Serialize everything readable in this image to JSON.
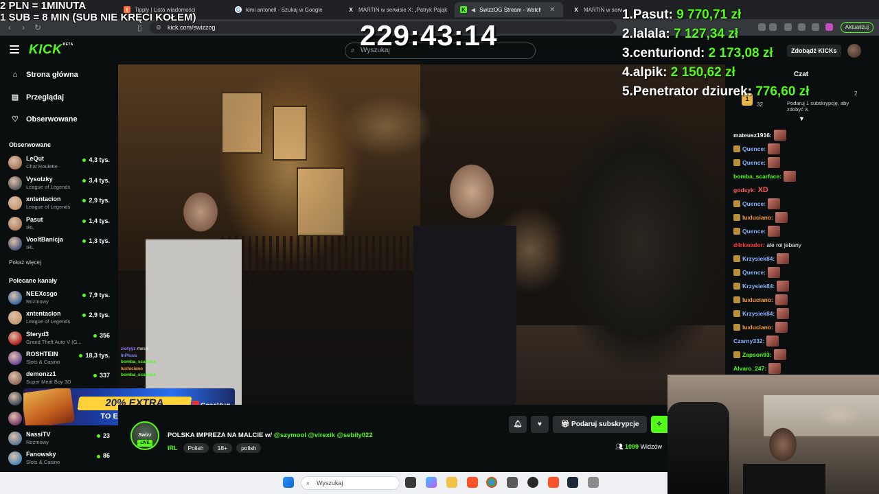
{
  "overlay": {
    "rate_line1": "2 PLN =  1MINUTA",
    "rate_line2": "1 SUB = 8 MIN (SUB NIE KRĘCI KOŁEM)",
    "timer": "229:43:14",
    "leaderboard": [
      {
        "rank_name": "1.Pasut:",
        "amount": "9 770,71 zł"
      },
      {
        "rank_name": "2.lalala:",
        "amount": "7 127,34 zł"
      },
      {
        "rank_name": "3.centuriond:",
        "amount": "2 173,08 zł"
      },
      {
        "rank_name": "4.alpik:",
        "amount": "2 150,62 zł"
      },
      {
        "rank_name": "5.Penetrator dziurek:",
        "amount": "776,60 zł"
      }
    ]
  },
  "browser": {
    "tabs": [
      {
        "label": "Tipply | Lista wiadomości",
        "active": false
      },
      {
        "label": "kimi antonell - Szukaj w Google",
        "active": false
      },
      {
        "label": "MARTIN w serwisie X: „Patryk Pająk",
        "active": false
      },
      {
        "label": "SwizzOG Stream - Watch Live",
        "active": true
      },
      {
        "label": "MARTIN w serwisie X: „Dzięki mocy",
        "active": false
      }
    ],
    "url": "kick.com/swizzog",
    "update_label": "Aktualizuj"
  },
  "header": {
    "logo": "KICK",
    "logo_badge": "BETA",
    "search_placeholder": "Wyszukaj",
    "kicks_button": "Zdobądź KICKs"
  },
  "sidebar": {
    "nav": [
      {
        "label": "Strona główna",
        "icon": "home-icon"
      },
      {
        "label": "Przeglądaj",
        "icon": "browse-icon"
      },
      {
        "label": "Obserwowane",
        "icon": "heart-icon"
      }
    ],
    "followed_title": "Obserwowane",
    "followed": [
      {
        "name": "LeQut",
        "category": "Chat Roulette",
        "viewers": "4,3 tys.",
        "color": "#a8785a"
      },
      {
        "name": "Vysotzky",
        "category": "League of Legends",
        "viewers": "3,4 tys.",
        "color": "#5d5d5d"
      },
      {
        "name": "xntentacion",
        "category": "League of Legends",
        "viewers": "2,9 tys.",
        "color": "#c49a74"
      },
      {
        "name": "Pasut",
        "category": "IRL",
        "viewers": "1,4 tys.",
        "color": "#b08060"
      },
      {
        "name": "VooltBanicja",
        "category": "IRL",
        "viewers": "1,3 tys.",
        "color": "#4a5a7a"
      }
    ],
    "show_more": "Pokaż więcej",
    "recommended_title": "Polecane kanały",
    "recommended": [
      {
        "name": "NEEXcsgo",
        "category": "Rozmowy",
        "viewers": "7,9 tys.",
        "color": "#3a6aa0"
      },
      {
        "name": "xntentacion",
        "category": "League of Legends",
        "viewers": "2,9 tys.",
        "color": "#c49a74"
      },
      {
        "name": "Steryd3",
        "category": "Grand Theft Auto V (G...",
        "viewers": "356",
        "color": "#b02020"
      },
      {
        "name": "ROSHTEIN",
        "category": "Slots & Casino",
        "viewers": "18,3 tys.",
        "color": "#6a4a9a"
      },
      {
        "name": "demonzz1",
        "category": "Super Meat Boy 3D",
        "viewers": "337",
        "color": "#8a6a5a"
      },
      {
        "name": "",
        "category": "",
        "viewers": "",
        "color": "#3a4a5a"
      },
      {
        "name": "",
        "category": "",
        "viewers": "",
        "color": "#7a3a6a"
      },
      {
        "name": "NassiTV",
        "category": "Rozmowy",
        "viewers": "23",
        "color": "#5a7a9a"
      },
      {
        "name": "Fanowsky",
        "category": "Slots & Casino",
        "viewers": "86",
        "color": "#4a8aba"
      }
    ]
  },
  "video_chat_overlay": [
    {
      "user": "zlotyyz",
      "text": "messi",
      "color": "#9b7bff"
    },
    {
      "user": "InPluus",
      "text": "",
      "color": "#7f8bff"
    },
    {
      "user": "bomba_scarface",
      "text": "",
      "color": "#53fc18"
    },
    {
      "user": "luxluciano",
      "text": "",
      "color": "#ff9f3a"
    },
    {
      "user": "bomba_scarface",
      "text": "",
      "color": "#53fc18"
    }
  ],
  "promo": {
    "percent": "20% EXTRA",
    "subtitle": "TO EVERY TOP-UP",
    "brand": "CaseHug"
  },
  "stream": {
    "avatar_text": "Swizz",
    "live": "LIVE",
    "title": "POLSKA IMPREZA NA MALCIE w/",
    "mentions": "@szymool @virexik @sebily022",
    "category": "IRL",
    "tags": [
      "Polish",
      "18+",
      "polish"
    ],
    "gift_sub": "Podaruj subskrypcje",
    "viewers_count": "1099",
    "viewers_label": "Widzów"
  },
  "chat": {
    "title": "Czat",
    "pinned_count_left": "32",
    "pinned_count_right": "2",
    "pinned_text": "Podaruj 1 subskrypcję, aby zdobyć 3.",
    "messages": [
      {
        "user": "mateusz1916:",
        "color": "#ffffff",
        "badge": false,
        "text": "",
        "emote": true
      },
      {
        "user": "Quence:",
        "color": "#8ab4ff",
        "badge": true,
        "text": "",
        "emote": true
      },
      {
        "user": "Quence:",
        "color": "#8ab4ff",
        "badge": true,
        "text": "",
        "emote": true
      },
      {
        "user": "bomba_scarface:",
        "color": "#53fc18",
        "badge": false,
        "text": "",
        "emote": true
      },
      {
        "user": "godsyk:",
        "color": "#ff5a5a",
        "badge": false,
        "text": "XD",
        "emote": false
      },
      {
        "user": "Quence:",
        "color": "#8ab4ff",
        "badge": true,
        "text": "",
        "emote": true
      },
      {
        "user": "luxluciano:",
        "color": "#ff9f3a",
        "badge": true,
        "text": "",
        "emote": true
      },
      {
        "user": "Quence:",
        "color": "#8ab4ff",
        "badge": true,
        "text": "",
        "emote": true
      },
      {
        "user": "d4rkwader:",
        "color": "#ff3a3a",
        "badge": false,
        "text": "ale roi jebany",
        "emote": false
      },
      {
        "user": "Krzysiek84:",
        "color": "#8ab4ff",
        "badge": true,
        "text": "",
        "emote": true
      },
      {
        "user": "Quence:",
        "color": "#8ab4ff",
        "badge": true,
        "text": "",
        "emote": true
      },
      {
        "user": "Krzysiek84:",
        "color": "#8ab4ff",
        "badge": true,
        "text": "",
        "emote": true
      },
      {
        "user": "luxluciano:",
        "color": "#ff9f3a",
        "badge": true,
        "text": "",
        "emote": true
      },
      {
        "user": "Krzysiek84:",
        "color": "#8ab4ff",
        "badge": true,
        "text": "",
        "emote": true
      },
      {
        "user": "luxluciano:",
        "color": "#ff9f3a",
        "badge": true,
        "text": "",
        "emote": true
      },
      {
        "user": "Czarny332:",
        "color": "#8ab4ff",
        "badge": false,
        "text": "",
        "emote": true
      },
      {
        "user": "Zapson93:",
        "color": "#53fc18",
        "badge": true,
        "text": "",
        "emote": true
      },
      {
        "user": "Alvaro_247:",
        "color": "#53fc18",
        "badge": false,
        "text": "",
        "emote": true
      }
    ]
  },
  "taskbar": {
    "search_placeholder": "Wyszukaj"
  },
  "colors": {
    "accent": "#53fc18",
    "background": "#0b0e0f"
  }
}
